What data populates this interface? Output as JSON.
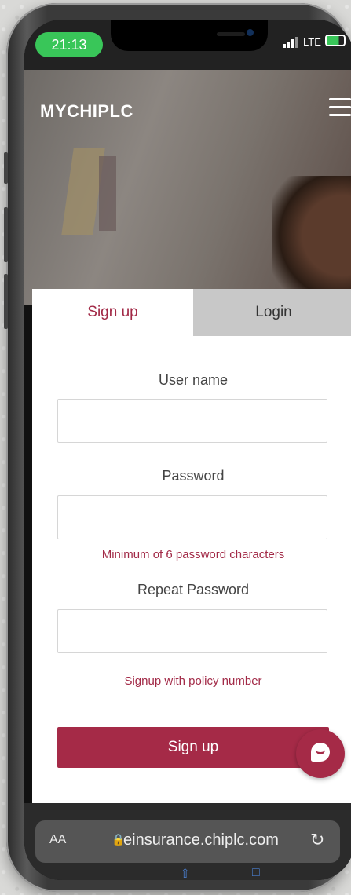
{
  "status": {
    "time": "21:13",
    "network": "LTE"
  },
  "header": {
    "brand": "MYCHIPLC"
  },
  "tabs": {
    "signup": "Sign up",
    "login": "Login"
  },
  "form": {
    "username_label": "User name",
    "password_label": "Password",
    "password_hint": "Minimum of 6 password characters",
    "repeat_label": "Repeat Password",
    "policy_link": "Signup with policy number",
    "submit": "Sign up"
  },
  "browser": {
    "aa": "AA",
    "url": "einsurance.chiplc.com",
    "lock_icon": "lock-icon",
    "reload_icon": "reload-icon"
  },
  "colors": {
    "accent": "#a52a47",
    "status_green": "#39c659"
  }
}
